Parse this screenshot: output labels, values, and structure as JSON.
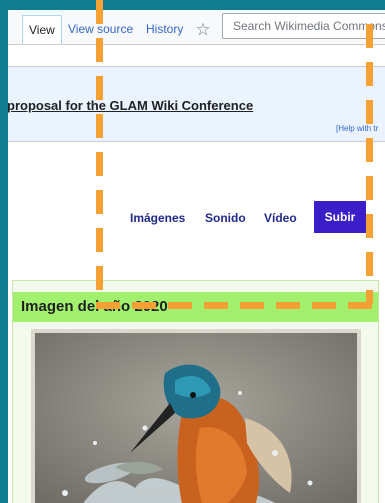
{
  "tabs": [
    {
      "label": "View",
      "active": true
    },
    {
      "label": "View source",
      "active": false
    },
    {
      "label": "History",
      "active": false
    }
  ],
  "watch_icon": "star-icon",
  "search": {
    "placeholder": "Search Wikimedia Commons"
  },
  "banner": {
    "link_text": "proposal for the GLAM Wiki Conference",
    "help_text": "[Help with tr"
  },
  "media_nav": {
    "items": [
      "Imágenes",
      "Sonido",
      "Vídeo"
    ],
    "upload_label": "Subir"
  },
  "potd": {
    "title": "Imagen del año 2020",
    "image_subject": "kingfisher-catching-fish-photo"
  },
  "colors": {
    "upload_button": "#3c1ec8",
    "potd_header": "#a2f16e",
    "link": "#3366cc",
    "overlay_dash": "#f7a033",
    "outer_frame": "#0f7c92"
  }
}
